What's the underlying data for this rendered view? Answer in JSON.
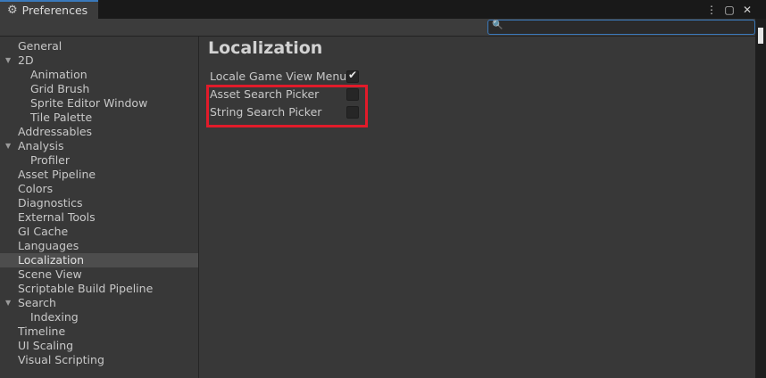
{
  "window": {
    "tab_title": "Preferences",
    "tab_icon": "gear-icon",
    "controls": [
      "more-icon",
      "maximize-icon",
      "close-icon"
    ]
  },
  "search": {
    "placeholder": "",
    "value": ""
  },
  "sidebar": {
    "items": [
      {
        "label": "General",
        "level": 0
      },
      {
        "label": "2D",
        "level": 0,
        "expanded": true
      },
      {
        "label": "Animation",
        "level": 1
      },
      {
        "label": "Grid Brush",
        "level": 1
      },
      {
        "label": "Sprite Editor Window",
        "level": 1
      },
      {
        "label": "Tile Palette",
        "level": 1
      },
      {
        "label": "Addressables",
        "level": 0
      },
      {
        "label": "Analysis",
        "level": 0,
        "expanded": true
      },
      {
        "label": "Profiler",
        "level": 1
      },
      {
        "label": "Asset Pipeline",
        "level": 0
      },
      {
        "label": "Colors",
        "level": 0
      },
      {
        "label": "Diagnostics",
        "level": 0
      },
      {
        "label": "External Tools",
        "level": 0
      },
      {
        "label": "GI Cache",
        "level": 0
      },
      {
        "label": "Languages",
        "level": 0
      },
      {
        "label": "Localization",
        "level": 0,
        "selected": true
      },
      {
        "label": "Scene View",
        "level": 0
      },
      {
        "label": "Scriptable Build Pipeline",
        "level": 0
      },
      {
        "label": "Search",
        "level": 0,
        "expanded": true
      },
      {
        "label": "Indexing",
        "level": 1
      },
      {
        "label": "Timeline",
        "level": 0
      },
      {
        "label": "UI Scaling",
        "level": 0
      },
      {
        "label": "Visual Scripting",
        "level": 0
      }
    ]
  },
  "main": {
    "title": "Localization",
    "settings": [
      {
        "label": "Locale Game View Menu",
        "checked": true
      },
      {
        "label": "Asset Search Picker",
        "checked": false
      },
      {
        "label": "String Search Picker",
        "checked": false
      }
    ]
  },
  "colors": {
    "accent": "#3a79bb",
    "highlight_box": "#e11b2a",
    "selected_row": "#4d4d4d"
  }
}
